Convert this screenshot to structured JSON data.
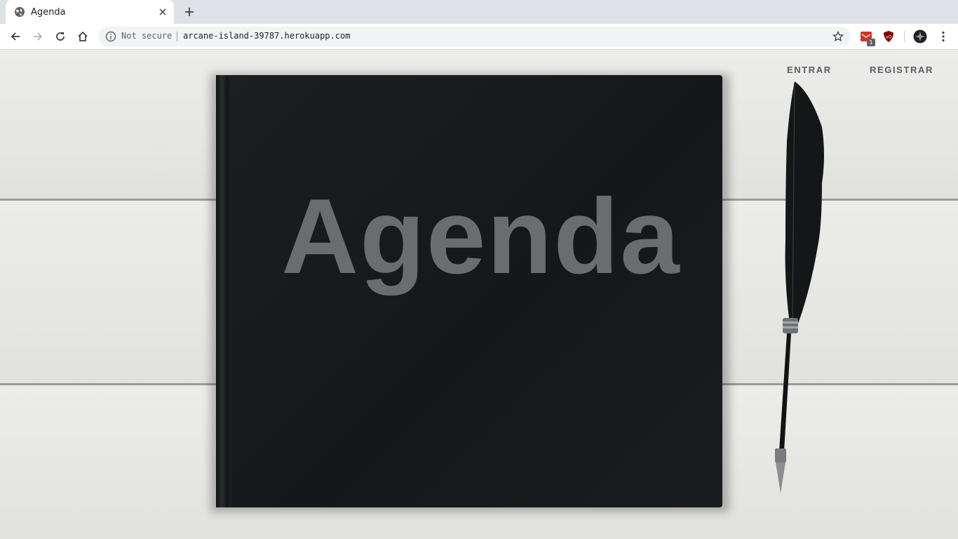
{
  "browser": {
    "tab": {
      "title": "Agenda"
    },
    "address_bar": {
      "security_label": "Not secure",
      "url": "arcane-island-39787.herokuapp.com"
    },
    "extensions": {
      "badge_count": "1"
    }
  },
  "page": {
    "book_title": "Agenda",
    "nav": {
      "login_label": "ENTRAR",
      "register_label": "REGISTRAR"
    }
  },
  "colors": {
    "book": "#171a1c",
    "title_text": "#6a6d6e",
    "nav_text": "#5a5e61",
    "background_wood": "#e9e9e7"
  }
}
